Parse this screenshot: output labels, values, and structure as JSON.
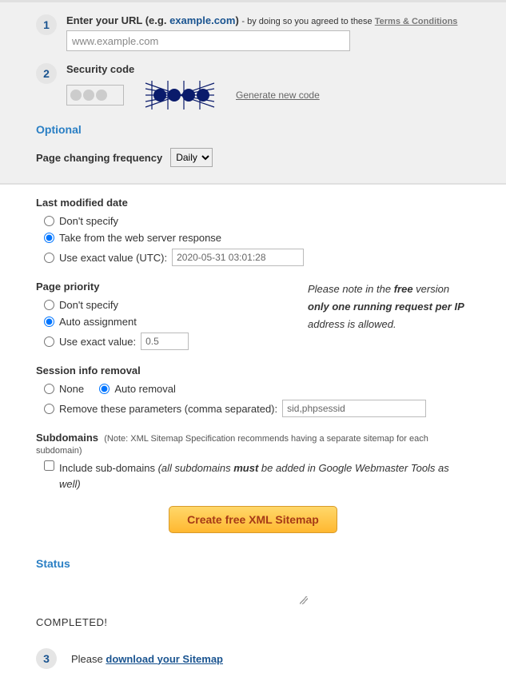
{
  "steps": {
    "one": "1",
    "two": "2",
    "three": "3"
  },
  "url": {
    "label_prefix": "Enter your URL (e.g. ",
    "example_link": "example.com",
    "label_suffix": ") ",
    "by_doing": "- by doing so you agreed to these ",
    "terms_link": "Terms & Conditions",
    "value": "www.example.com"
  },
  "security": {
    "label": "Security code",
    "generate_link": "Generate new code"
  },
  "optional_heading": "Optional",
  "frequency": {
    "label": "Page changing frequency",
    "selected": "Daily"
  },
  "last_modified": {
    "label": "Last modified date",
    "opt1": "Don't specify",
    "opt2": "Take from the web server response",
    "opt3": "Use exact value (UTC):",
    "value": "2020-05-31 03:01:28"
  },
  "priority": {
    "label": "Page priority",
    "opt1": "Don't specify",
    "opt2": "Auto assignment",
    "opt3": "Use exact value:",
    "value": "0.5"
  },
  "note": {
    "l1a": "Please note in the ",
    "l1b": "free",
    "l1c": " version ",
    "l1d": "only one running request per IP",
    "l1e": " address is allowed."
  },
  "session": {
    "label": "Session info removal",
    "opt1": "None",
    "opt2": "Auto removal",
    "opt3": "Remove these parameters (comma separated):",
    "value": "sid,phpsessid"
  },
  "subdomains": {
    "label": "Subdomains",
    "note": "(Note: XML Sitemap Specification recommends having a separate sitemap for each subdomain)",
    "check_a": "Include sub-domains ",
    "check_b": "(all subdomains ",
    "check_c": "must",
    "check_d": " be added in Google Webmaster Tools as well)"
  },
  "create_btn": "Create free XML Sitemap",
  "status": {
    "heading": "Status",
    "completed": "COMPLETED!",
    "please": "Please ",
    "download_link": "download your Sitemap"
  }
}
